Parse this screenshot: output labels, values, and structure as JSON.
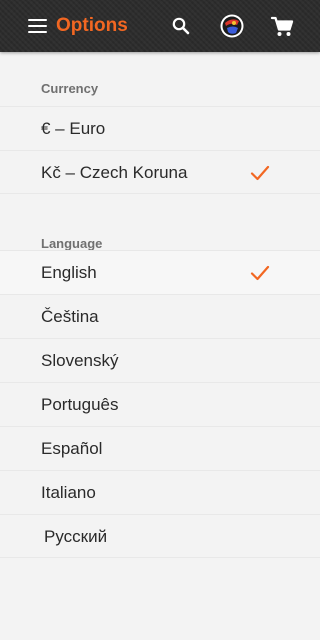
{
  "header": {
    "title": "Options",
    "icons": [
      "menu-icon",
      "search-icon",
      "avatar-icon",
      "cart-icon"
    ],
    "accent_color": "#f26722",
    "background_color": "#2c2c2c"
  },
  "currency": {
    "heading": "Currency",
    "items": [
      {
        "label": "€ – Euro",
        "selected": false
      },
      {
        "label": "Kč – Czech Koruna",
        "selected": true
      }
    ]
  },
  "language": {
    "heading": "Language",
    "items": [
      {
        "label": "English",
        "selected": true
      },
      {
        "label": "Čeština",
        "selected": false
      },
      {
        "label": "Slovenský",
        "selected": false
      },
      {
        "label": "Português",
        "selected": false
      },
      {
        "label": "Español",
        "selected": false
      },
      {
        "label": "Italiano",
        "selected": false
      },
      {
        "label": "Русский",
        "selected": false
      }
    ]
  },
  "check_color": "#f26722"
}
